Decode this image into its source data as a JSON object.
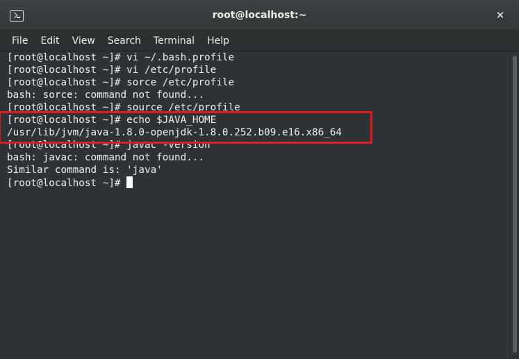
{
  "window": {
    "title": "root@localhost:~",
    "icon": "terminal-icon",
    "close_label": "✕"
  },
  "menu": {
    "items": [
      {
        "label": "File"
      },
      {
        "label": "Edit"
      },
      {
        "label": "View"
      },
      {
        "label": "Search"
      },
      {
        "label": "Terminal"
      },
      {
        "label": "Help"
      }
    ]
  },
  "terminal": {
    "lines": [
      "[root@localhost ~]# vi ~/.bash.profile",
      "[root@localhost ~]# vi /etc/profile",
      "[root@localhost ~]# sorce /etc/profile",
      "bash: sorce: command not found...",
      "[root@localhost ~]# source /etc/profile",
      "[root@localhost ~]# echo $JAVA_HOME",
      "/usr/lib/jvm/java-1.8.0-openjdk-1.8.0.252.b09.e16.x86_64",
      "[root@localhost ~]# javac -version",
      "bash: javac: command not found...",
      "Similar command is: 'java'"
    ],
    "prompt": "[root@localhost ~]#"
  },
  "colors": {
    "background": "#2e3436",
    "foreground": "#eeeeec",
    "highlight_border": "#e01b24"
  }
}
